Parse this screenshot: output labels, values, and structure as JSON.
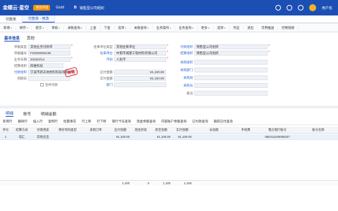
{
  "topbar": {
    "logo": "金蝶云·星空",
    "trial": "测试环境",
    "gold": "Gold",
    "b": "B",
    "company": "销售型公司组织",
    "user": "用户名"
  },
  "tabs": [
    {
      "label": "付款单"
    },
    {
      "label": "付款单 - 修改"
    }
  ],
  "toolbar": [
    "新增",
    "保存",
    "提交",
    "审核",
    "关联查询",
    "上查",
    "下查",
    "选单",
    "关联查询",
    "业务操作",
    "业务查询",
    "更多",
    "选项",
    "凭证",
    "退出",
    "可用推送",
    "控制链接",
    "退出"
  ],
  "subtabs": [
    "基本信息",
    "其他"
  ],
  "form": {
    "biz_type": {
      "label": "单据类型",
      "value": "其他业务付款单"
    },
    "bill_no": {
      "label": "单据编号",
      "value": "FKD00000138"
    },
    "biz_date": {
      "label": "业务日期",
      "value": "2026/4/14"
    },
    "org_unit": {
      "label": "结算组织",
      "value": "四维科技"
    },
    "pay_org": {
      "label": "付款组织",
      "value": "宁波市新天地材料科技有限公司"
    },
    "exp_date": {
      "label": "到期日",
      "value": ""
    },
    "same_org": {
      "label": "合并付款"
    },
    "cp_type": {
      "label": "往来单位类型",
      "value": "其他往来单位"
    },
    "cp": {
      "label": "往来单位",
      "value": "中南市城建工程材料有限公司"
    },
    "currency": {
      "label": "币别",
      "value": "人民币"
    },
    "total": {
      "label": "应付金额",
      "value": "¥1,100.00"
    },
    "actual": {
      "label": "实付金额",
      "value": "¥1,100.00"
    },
    "dept": {
      "label": "部门",
      "value": ""
    },
    "pay_org2": {
      "label": "付款组织",
      "value": "销售型公司组织"
    },
    "settle_org": {
      "label": "结算组织",
      "value": "销售型公司组织"
    },
    "purchase_org": {
      "label": "采购组织",
      "value": ""
    },
    "purchase_dept": {
      "label": "采购部门",
      "value": ""
    },
    "purchase_group": {
      "label": "采购组",
      "value": ""
    },
    "purchaser": {
      "label": "采购员",
      "value": ""
    },
    "remark": {
      "label": "备注",
      "value": ""
    }
  },
  "stamp": "审核",
  "lower_tabs": [
    "明细",
    "账号",
    "明细金额"
  ],
  "sub_toolbar": [
    "新增行",
    "删除行",
    "插入行",
    "复制行",
    "批量填充",
    "行上移",
    "行下移",
    "银行卡号查询",
    "现金余额查询",
    "内部账户余额查询",
    "已付款查询",
    "跟踪已付查询"
  ],
  "columns": [
    "序号",
    "结算方式",
    "付款用途",
    "预付项目类型",
    "采购订单",
    "应付金额",
    "现金折扣",
    "折后金额",
    "实付金额",
    "长短款",
    "手续费",
    "我方银行账号",
    "账号名称"
  ],
  "row": {
    "cols": [
      "1",
      "电汇",
      "其他支出",
      "",
      "",
      "¥1,100.00",
      "",
      "¥1,100.00",
      "¥1,100.00",
      "",
      "",
      "860411100005337",
      ""
    ]
  },
  "totals": [
    "1,100",
    "0",
    "1,100",
    "1,100"
  ]
}
